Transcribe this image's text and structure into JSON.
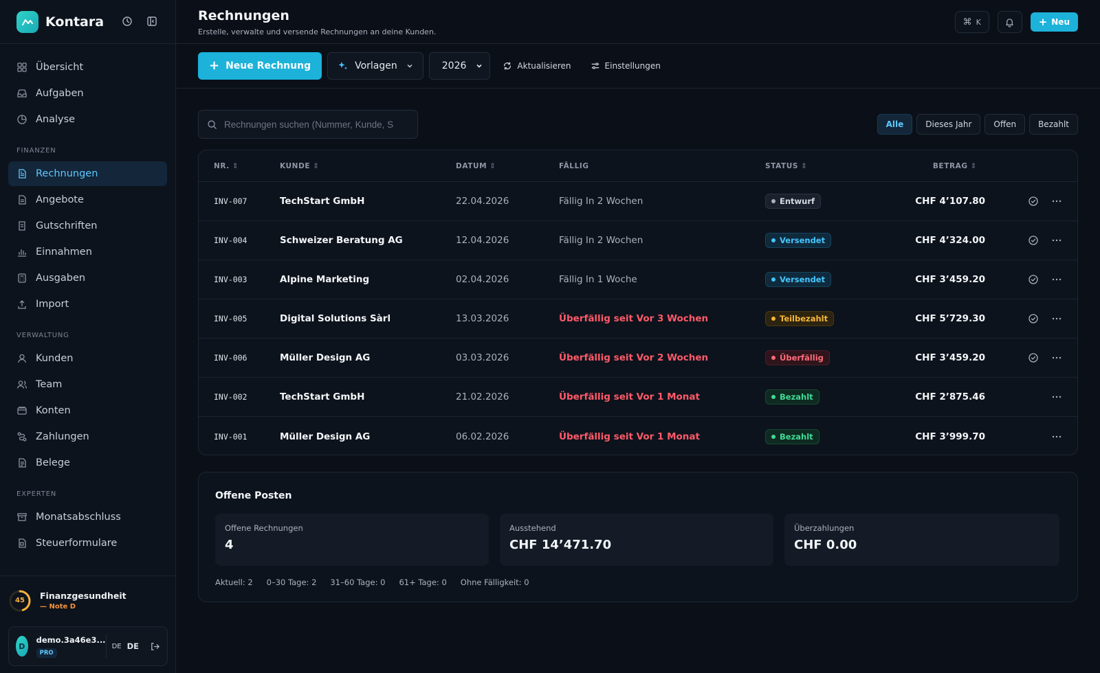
{
  "sidebar": {
    "brand": "Kontara",
    "items_top": [
      {
        "label": "Übersicht",
        "icon": "grid-icon"
      },
      {
        "label": "Aufgaben",
        "icon": "inbox-icon"
      },
      {
        "label": "Analyse",
        "icon": "pie-chart-icon"
      }
    ],
    "section_finanzen": "FINANZEN",
    "items_finanzen": [
      {
        "label": "Rechnungen",
        "icon": "file-text-icon",
        "active": true
      },
      {
        "label": "Angebote",
        "icon": "file-icon"
      },
      {
        "label": "Gutschriften",
        "icon": "receipt-icon"
      },
      {
        "label": "Einnahmen",
        "icon": "bar-chart-icon"
      },
      {
        "label": "Ausgaben",
        "icon": "calculator-icon"
      },
      {
        "label": "Import",
        "icon": "upload-icon"
      }
    ],
    "section_verwaltung": "VERWALTUNG",
    "items_verwaltung": [
      {
        "label": "Kunden",
        "icon": "user-icon"
      },
      {
        "label": "Team",
        "icon": "users-icon"
      },
      {
        "label": "Konten",
        "icon": "wallet-icon"
      },
      {
        "label": "Zahlungen",
        "icon": "route-icon"
      },
      {
        "label": "Belege",
        "icon": "document-icon"
      }
    ],
    "section_experten": "EXPERTEN",
    "items_experten": [
      {
        "label": "Monatsabschluss",
        "icon": "archive-icon"
      },
      {
        "label": "Steuerformulare",
        "icon": "form-icon"
      }
    ],
    "health": {
      "score": "45",
      "title": "Finanzgesundheit",
      "note": "— Note D"
    },
    "user": {
      "initial": "D",
      "name": "demo.3a46e3...",
      "plan": "PRO",
      "lang_small": "DE",
      "lang": "DE"
    }
  },
  "header": {
    "title": "Rechnungen",
    "subtitle": "Erstelle, verwalte und versende Rechnungen an deine Kunden.",
    "shortcut": "K",
    "new_label": "Neu"
  },
  "toolbar": {
    "new_invoice": "Neue Rechnung",
    "templates": "Vorlagen",
    "year": "2026",
    "year_options": [
      "2026"
    ],
    "refresh": "Aktualisieren",
    "settings": "Einstellungen"
  },
  "search": {
    "placeholder": "Rechnungen suchen (Nummer, Kunde, S"
  },
  "filters": [
    "Alle",
    "Dieses Jahr",
    "Offen",
    "Bezahlt"
  ],
  "table": {
    "headers": {
      "nr": "NR.",
      "kunde": "KUNDE",
      "datum": "DATUM",
      "faellig": "FÄLLIG",
      "status": "STATUS",
      "betrag": "BETRAG"
    },
    "rows": [
      {
        "nr": "INV-007",
        "kunde": "TechStart GmbH",
        "datum": "22.04.2026",
        "faellig": "Fällig In 2 Wochen",
        "overdue": false,
        "status": "Entwurf",
        "status_type": "entwurf",
        "betrag": "CHF 4’107.80",
        "check": true
      },
      {
        "nr": "INV-004",
        "kunde": "Schweizer Beratung AG",
        "datum": "12.04.2026",
        "faellig": "Fällig In 2 Wochen",
        "overdue": false,
        "status": "Versendet",
        "status_type": "versendet",
        "betrag": "CHF 4’324.00",
        "check": true
      },
      {
        "nr": "INV-003",
        "kunde": "Alpine Marketing",
        "datum": "02.04.2026",
        "faellig": "Fällig In 1 Woche",
        "overdue": false,
        "status": "Versendet",
        "status_type": "versendet",
        "betrag": "CHF 3’459.20",
        "check": true
      },
      {
        "nr": "INV-005",
        "kunde": "Digital Solutions Sàrl",
        "datum": "13.03.2026",
        "faellig": "Überfällig seit Vor 3 Wochen",
        "overdue": true,
        "status": "Teilbezahlt",
        "status_type": "teilbezahlt",
        "betrag": "CHF 5’729.30",
        "check": true
      },
      {
        "nr": "INV-006",
        "kunde": "Müller Design AG",
        "datum": "03.03.2026",
        "faellig": "Überfällig seit Vor 2 Wochen",
        "overdue": true,
        "status": "Überfällig",
        "status_type": "ueberfaellig",
        "betrag": "CHF 3’459.20",
        "check": true
      },
      {
        "nr": "INV-002",
        "kunde": "TechStart GmbH",
        "datum": "21.02.2026",
        "faellig": "Überfällig seit Vor 1 Monat",
        "overdue": true,
        "status": "Bezahlt",
        "status_type": "bezahlt",
        "betrag": "CHF 2’875.46",
        "check": false
      },
      {
        "nr": "INV-001",
        "kunde": "Müller Design AG",
        "datum": "06.02.2026",
        "faellig": "Überfällig seit Vor 1 Monat",
        "overdue": true,
        "status": "Bezahlt",
        "status_type": "bezahlt",
        "betrag": "CHF 3’999.70",
        "check": false
      }
    ]
  },
  "posten": {
    "title": "Offene Posten",
    "cards": [
      {
        "label": "Offene Rechnungen",
        "value": "4"
      },
      {
        "label": "Ausstehend",
        "value": "CHF 14’471.70"
      },
      {
        "label": "Überzahlungen",
        "value": "CHF 0.00"
      }
    ],
    "aging": [
      "Aktuell: 2",
      "0–30 Tage: 2",
      "31–60 Tage: 0",
      "61+ Tage: 0",
      "Ohne Fälligkeit: 0"
    ]
  },
  "colors": {
    "accent": "#1cb2da",
    "active_nav": "#5fc9ff",
    "overdue": "#ff5a6a",
    "background": "#0b1018"
  }
}
